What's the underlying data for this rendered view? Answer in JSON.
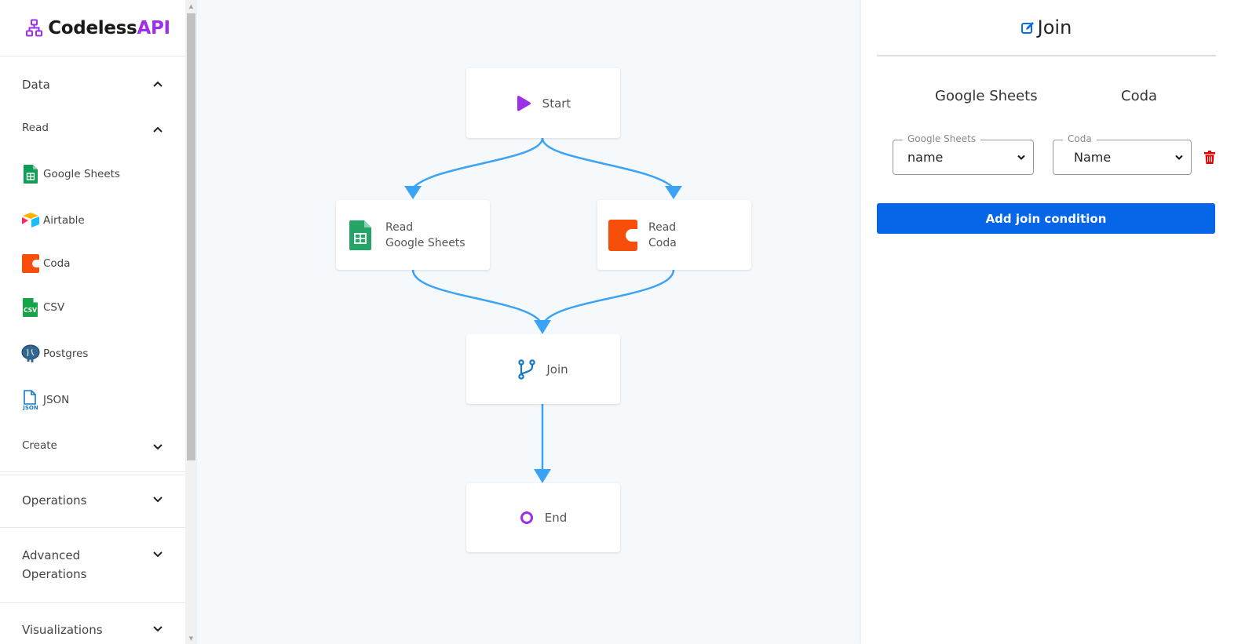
{
  "app": {
    "logo_text": "Codeless",
    "logo_accent": "API",
    "accent_color": "#9b30e8"
  },
  "sidebar": {
    "sections": [
      {
        "label": "Data",
        "expanded": true
      },
      {
        "label": "Operations",
        "expanded": false
      },
      {
        "label": "Advanced Operations",
        "expanded": false
      },
      {
        "label": "Visualizations",
        "expanded": false
      }
    ],
    "data_subsections": [
      {
        "label": "Read",
        "expanded": true
      },
      {
        "label": "Create",
        "expanded": false
      }
    ],
    "read_items": [
      {
        "label": "Google Sheets",
        "icon": "google-sheets-icon"
      },
      {
        "label": "Airtable",
        "icon": "airtable-icon"
      },
      {
        "label": "Coda",
        "icon": "coda-icon"
      },
      {
        "label": "CSV",
        "icon": "csv-icon"
      },
      {
        "label": "Postgres",
        "icon": "postgres-icon"
      },
      {
        "label": "JSON",
        "icon": "json-icon"
      }
    ]
  },
  "flow": {
    "edge_color": "#3aa3f5",
    "nodes": [
      {
        "id": "start",
        "label": "Start",
        "icon": "play-icon"
      },
      {
        "id": "read-sheets",
        "label_top": "Read",
        "label_bottom": "Google Sheets",
        "icon": "google-sheets-icon"
      },
      {
        "id": "read-coda",
        "label_top": "Read",
        "label_bottom": "Coda",
        "icon": "coda-icon"
      },
      {
        "id": "join",
        "label": "Join",
        "icon": "branch-icon"
      },
      {
        "id": "end",
        "label": "End",
        "icon": "circle-icon"
      }
    ]
  },
  "panel": {
    "title": "Join",
    "left_source": "Google Sheets",
    "right_source": "Coda",
    "conditions": [
      {
        "left_label": "Google Sheets",
        "left_value": "name",
        "right_label": "Coda",
        "right_value": "Name"
      }
    ],
    "add_button": "Add join condition",
    "button_color": "#0766e8",
    "delete_color": "#e00000"
  }
}
